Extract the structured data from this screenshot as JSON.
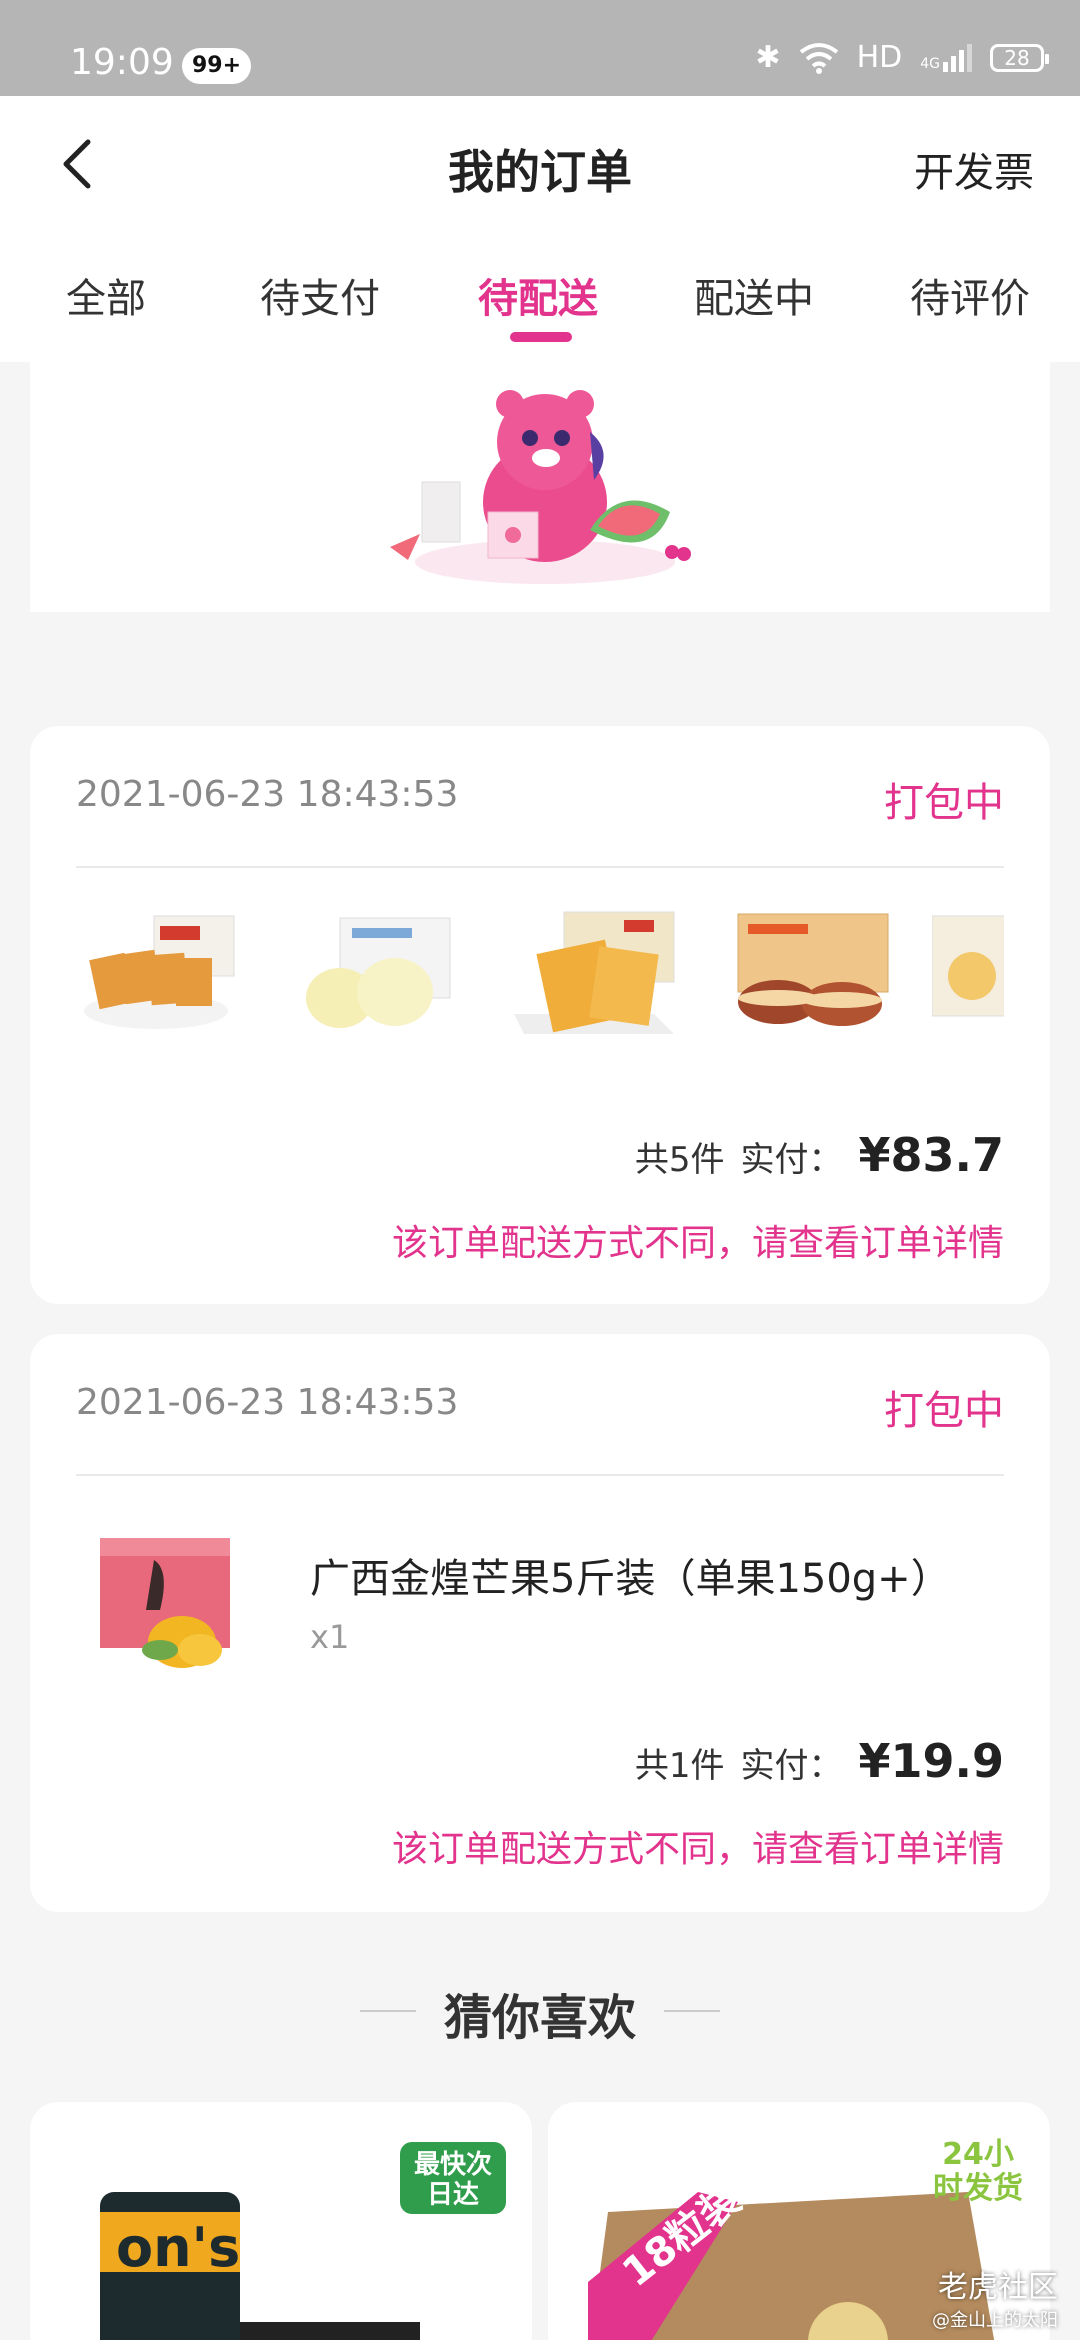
{
  "status_bar": {
    "time": "19:09",
    "notif_badge": "99+",
    "network": "HD",
    "signal_label": "4G",
    "battery": "28"
  },
  "header": {
    "title": "我的订单",
    "invoice_label": "开发票"
  },
  "tabs": [
    {
      "label": "全部"
    },
    {
      "label": "待支付"
    },
    {
      "label": "待配送",
      "active": true
    },
    {
      "label": "配送中"
    },
    {
      "label": "待评价"
    }
  ],
  "orders": [
    {
      "datetime": "2021-06-23 18:43:53",
      "status": "打包中",
      "items": [
        "crispy-rice-cracker",
        "steamed-bread",
        "waffle",
        "dorayaki",
        "egg-tart"
      ],
      "count_text": "共5件",
      "paid_label": "实付：",
      "price": "¥83.7",
      "note": "该订单配送方式不同，请查看订单详情"
    },
    {
      "datetime": "2021-06-23 18:43:53",
      "status": "打包中",
      "product_name": "广西金煌芒果5斤装（单果150g+）",
      "quantity": "x1",
      "count_text": "共1件",
      "paid_label": "实付：",
      "price": "¥19.9",
      "note": "该订单配送方式不同，请查看订单详情"
    }
  ],
  "recommend": {
    "title": "猜你喜欢",
    "card1_badge": "最快次日达",
    "card2_badge": "18粒装",
    "card2_promo": "24小时发货"
  },
  "watermark": {
    "brand": "老虎社区",
    "author": "@金山上的太阳"
  },
  "colors": {
    "accent": "#e2338d",
    "background": "#f5f5f5",
    "status_bar": "#b5b5b5"
  }
}
